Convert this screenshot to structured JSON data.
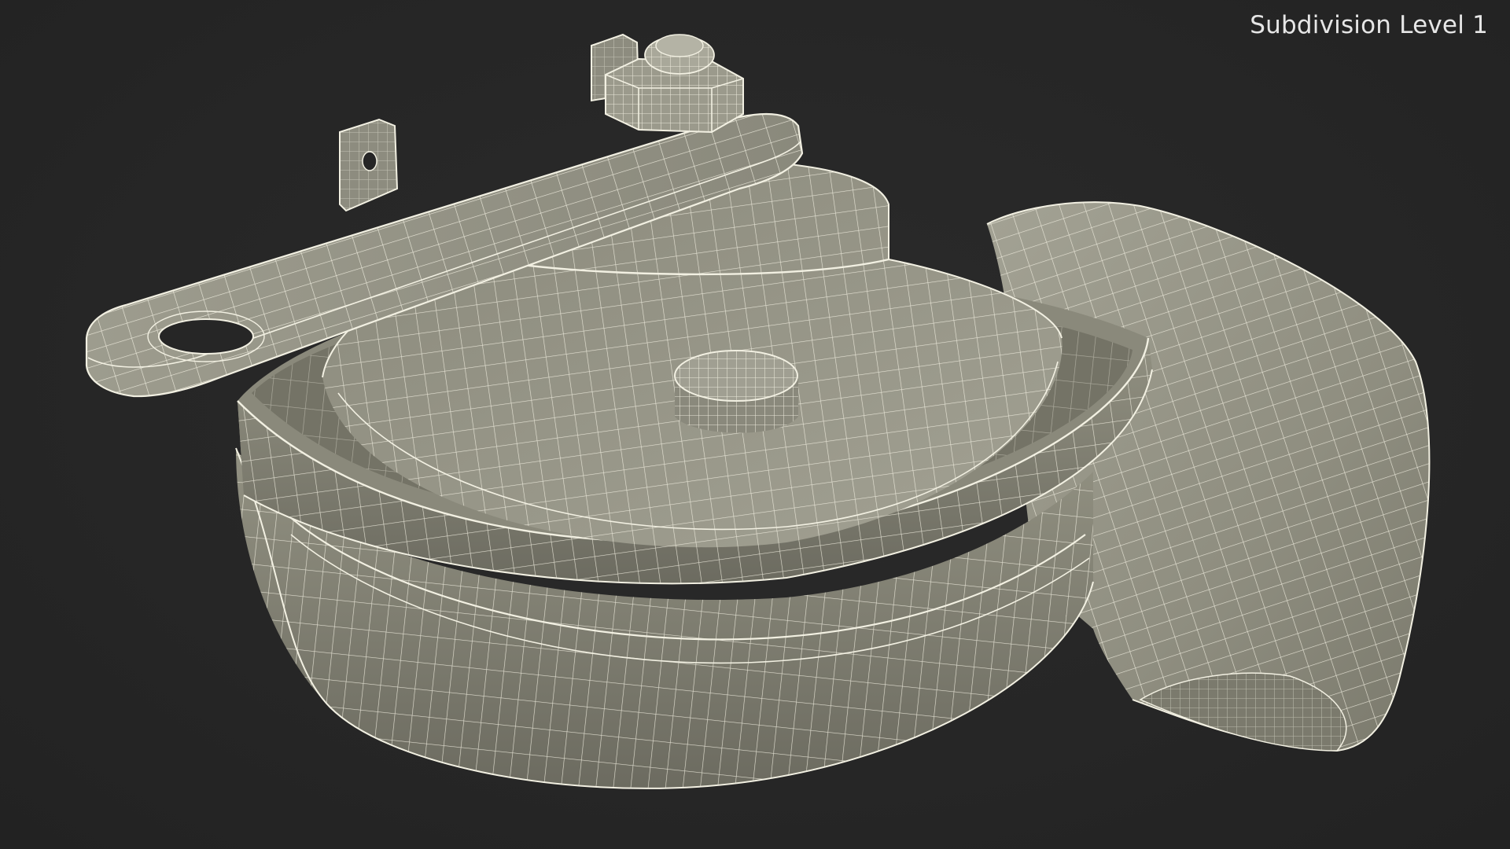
{
  "viewport": {
    "overlay_label": "Subdivision Level 1",
    "background_color": "#262626",
    "model_fill_color": "#8b8a7c",
    "wire_color": "#f2f0e2"
  }
}
